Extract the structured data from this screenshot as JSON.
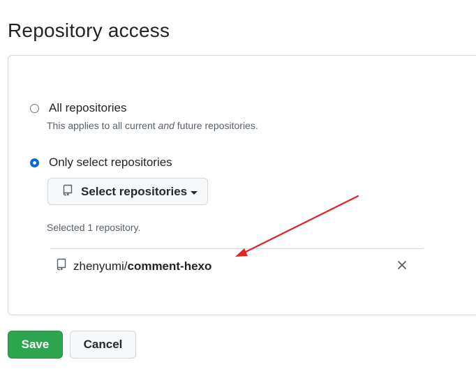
{
  "page": {
    "title": "Repository access"
  },
  "access": {
    "all": {
      "label": "All repositories",
      "desc_pre": "This applies to all current ",
      "desc_em": "and",
      "desc_post": " future repositories.",
      "checked": false
    },
    "select": {
      "label": "Only select repositories",
      "checked": true
    },
    "select_button_label": "Select repositories",
    "selected_count_text": "Selected 1 repository.",
    "selected_repos": [
      {
        "owner": "zhenyumi/",
        "name": "comment-hexo"
      }
    ]
  },
  "actions": {
    "save_label": "Save",
    "cancel_label": "Cancel"
  },
  "colors": {
    "accent": "#0969da",
    "save_green": "#2da44e",
    "annotation_arrow": "#e02424"
  },
  "icons": {
    "repo": "repo-icon",
    "remove": "close-icon",
    "caret": "caret-down-icon"
  }
}
